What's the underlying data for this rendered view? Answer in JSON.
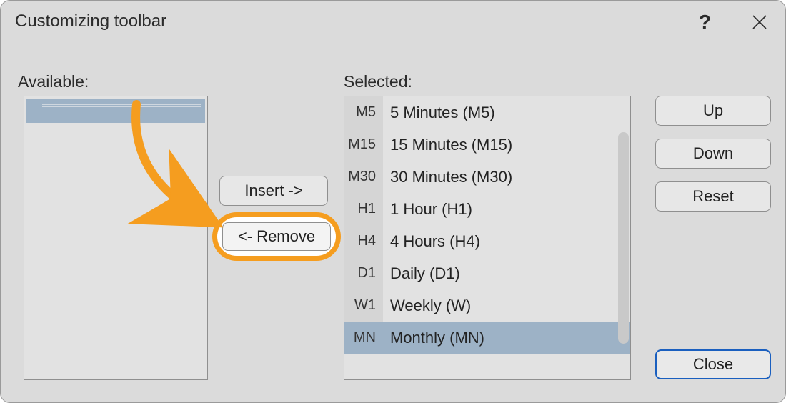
{
  "window": {
    "title": "Customizing toolbar"
  },
  "labels": {
    "available": "Available:",
    "selected": "Selected:"
  },
  "buttons": {
    "insert": "Insert ->",
    "remove": "<- Remove",
    "up": "Up",
    "down": "Down",
    "reset": "Reset",
    "close": "Close"
  },
  "available_items": [],
  "selected_items": [
    {
      "code": "M5",
      "label": "5 Minutes (M5)",
      "selected": false
    },
    {
      "code": "M15",
      "label": "15 Minutes (M15)",
      "selected": false
    },
    {
      "code": "M30",
      "label": "30 Minutes (M30)",
      "selected": false
    },
    {
      "code": "H1",
      "label": "1 Hour (H1)",
      "selected": false
    },
    {
      "code": "H4",
      "label": "4 Hours (H4)",
      "selected": false
    },
    {
      "code": "D1",
      "label": "Daily (D1)",
      "selected": false
    },
    {
      "code": "W1",
      "label": "Weekly (W)",
      "selected": false
    },
    {
      "code": "MN",
      "label": "Monthly (MN)",
      "selected": true
    }
  ],
  "annotation": {
    "arrow_target": "remove-button"
  }
}
